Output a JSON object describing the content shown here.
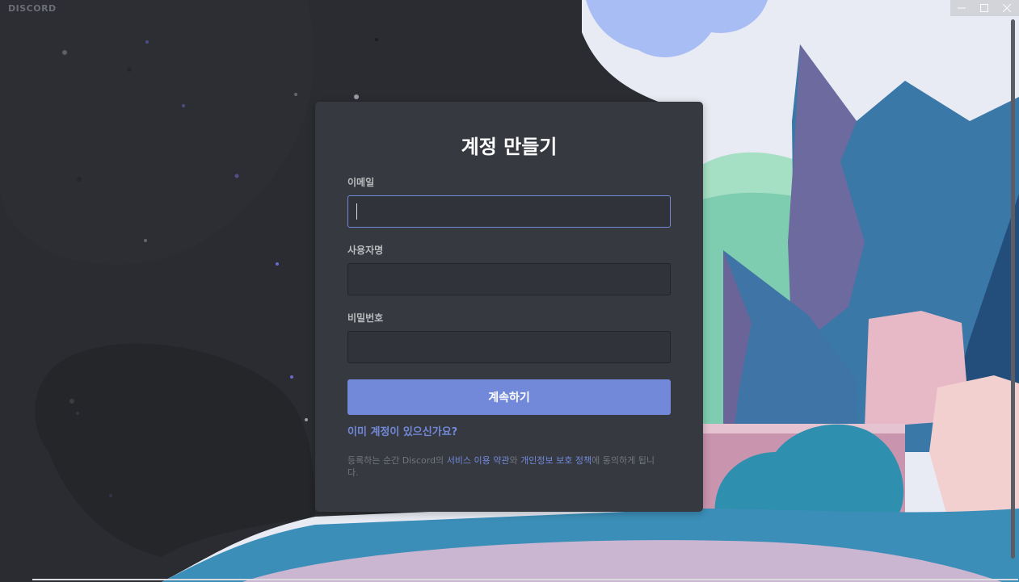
{
  "app": {
    "brand": "DISCORD"
  },
  "window_controls": {
    "minimize_icon": "minimize-icon",
    "maximize_icon": "maximize-icon",
    "close_icon": "close-icon"
  },
  "register": {
    "title": "계정 만들기",
    "email_label": "이메일",
    "email_value": "",
    "username_label": "사용자명",
    "username_value": "",
    "password_label": "비밀번호",
    "password_value": "",
    "submit_label": "계속하기",
    "login_link": "이미 계정이 있으신가요?",
    "terms_prefix": "등록하는 순간 Discord의 ",
    "terms_link": "서비스 이용 약관",
    "terms_middle": "와 ",
    "privacy_link": "개인정보 보호 정책",
    "terms_suffix": "에 동의하게 됩니다."
  },
  "colors": {
    "accent": "#7289da",
    "card_background": "#36393f",
    "input_background": "#303339",
    "page_dark": "#2b2c31"
  }
}
